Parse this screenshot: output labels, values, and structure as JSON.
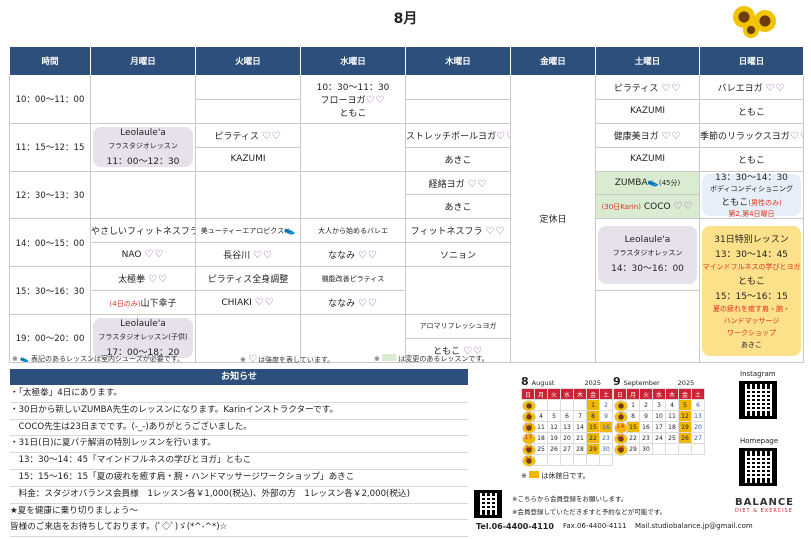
{
  "title": "8月",
  "days": [
    "時間",
    "月曜日",
    "火曜日",
    "水曜日",
    "木曜日",
    "金曜日",
    "土曜日",
    "日曜日"
  ],
  "times": [
    "10：00～11：00",
    "11：15～12：15",
    "12：30～13：30",
    "14：00～15：00",
    "15：30～16：30",
    "19：00～20：00"
  ],
  "cells": {
    "r1_wed_time": "10：30～11：30",
    "r1_wed_class": "フローヨガ",
    "r1_wed_teacher": "ともこ",
    "r1_sat_class": "ピラティス",
    "r1_sat_teacher": "KAZUMI",
    "r1_sun_class": "バレエヨガ",
    "r1_sun_teacher": "ともこ",
    "r2_mon_name": "Leolaule'a",
    "r2_mon_sub": "フラスタジオレッスン",
    "r2_mon_time": "11：00～12：30",
    "r2_tue_class": "ピラティス",
    "r2_tue_teacher": "KAZUMI",
    "r2_thu_class": "ストレッチポールヨガ",
    "r2_thu_teacher": "あきこ",
    "r2_sat_class": "健康美ヨガ",
    "r2_sat_teacher": "KAZUMI",
    "r2_sun_class": "季節のリラックスヨガ",
    "r2_sun_teacher": "ともこ",
    "r3_thu_class": "経絡ヨガ",
    "r3_thu_teacher": "あきこ",
    "r3_sat_class": "ZUMBA",
    "r3_sat_note": "(45分)",
    "r3_sat_teacher_pre": "(30日Karin)",
    "r3_sat_teacher": "COCO",
    "r3_sun_time": "13：30～14：30",
    "r3_sun_class": "ボディコンディショニング",
    "r3_sun_teacher": "ともこ",
    "r3_sun_teacher_note": "(男性のみ)",
    "r3_sun_note": "第2,第4日曜日",
    "r4_mon_class": "やさしいフィットネスフラ",
    "r4_mon_teacher": "NAO",
    "r4_tue_class": "美ューティーエアロビクス",
    "r4_tue_teacher": "長谷川",
    "r4_wed_class": "大人から始めるバレエ",
    "r4_wed_teacher": "ななみ",
    "r4_thu_class": "フィットネスフラ",
    "r4_thu_teacher": "ソニョン",
    "r4_sat_name": "Leolaule'a",
    "r4_sat_sub": "フラスタジオレッスン",
    "r4_sat_time": "14：30～16：00",
    "r4_sun_title": "31日特別レッスン",
    "r4_sun_time1": "13：30～14：45",
    "r4_sun_class1": "マインドフルネスの学びとヨガ",
    "r4_sun_teacher1": "ともこ",
    "r4_sun_time2": "15：15～16：15",
    "r4_sun_class2a": "夏の疲れを癒す肩・腕・",
    "r4_sun_class2b": "ハンドマッサージ",
    "r4_sun_class2c": "ワークショップ",
    "r4_sun_teacher2": "あきこ",
    "r5_mon_class": "太極拳",
    "r5_mon_teacher_pre": "(4日のみ)",
    "r5_mon_teacher": "山下幸子",
    "r5_tue_class": "ピラティス全身調整",
    "r5_tue_teacher": "CHIAKI",
    "r5_wed_class": "機能改善ピラティス",
    "r5_wed_teacher": "ななみ",
    "r6_mon_name": "Leolaule'a",
    "r6_mon_sub": "フラスタジオレッスン(子供)",
    "r6_mon_time": "17：00～18：20",
    "r6_thu_class": "アロマリフレッシュヨガ",
    "r6_thu_teacher": "ともこ",
    "closed": "定休日"
  },
  "notes": {
    "shoes": "表記のあるレッスンは室内シューズが必要です。",
    "hearts": "は強度を表しています。",
    "changed": "は変更のあるレッスンです。"
  },
  "news": {
    "title": "お知らせ",
    "lines": [
      "・「太極拳」4日にあります。",
      "・30日から新しいZUMBA先生のレッスンになります。Karinインストラクターです。",
      "　COCO先生は23日までです。(‐_‐)ありがとうございました。",
      "・31日(日)に夏バテ解消の特別レッスンを行います。",
      "　13：30～14：45「マインドフルネスの学びとヨガ」ともこ",
      "　15：15～16：15「夏の疲れを癒す肩・腕・ハンドマッサージワークショップ」あきこ",
      "　料金：スタジオバランス会員様　1レッスン各￥1,000(税込)、外部の方　1レッスン各￥2,000(税込)",
      "★夏を健康に乗り切りましょう～",
      "皆様のご来店をお待ちしております。(ﾟ◇ﾟ)ゞ(*^-^*)☆"
    ]
  },
  "calendar": {
    "aug_num": "8",
    "aug_name": "August",
    "aug_year": "2025",
    "sep_num": "9",
    "sep_name": "September",
    "sep_year": "2025",
    "dow": [
      "日",
      "月",
      "火",
      "水",
      "木",
      "金",
      "土"
    ],
    "aug_weeks": [
      [
        "",
        "",
        "",
        "",
        "",
        "1",
        "2"
      ],
      [
        "3",
        "4",
        "5",
        "6",
        "7",
        "8",
        "9"
      ],
      [
        "10",
        "11",
        "12",
        "13",
        "14",
        "15",
        "16"
      ],
      [
        "17",
        "18",
        "19",
        "20",
        "21",
        "22",
        "23"
      ],
      [
        "24",
        "25",
        "26",
        "27",
        "28",
        "29",
        "30"
      ],
      [
        "31",
        "",
        "",
        "",
        "",
        "",
        ""
      ]
    ],
    "sep_weeks": [
      [
        "",
        "1",
        "2",
        "3",
        "4",
        "5",
        "6"
      ],
      [
        "7",
        "8",
        "9",
        "10",
        "11",
        "12",
        "13"
      ],
      [
        "14",
        "15",
        "16",
        "17",
        "18",
        "19",
        "20"
      ],
      [
        "21",
        "22",
        "23",
        "24",
        "25",
        "26",
        "27"
      ],
      [
        "28",
        "29",
        "30",
        "",
        "",
        "",
        ""
      ]
    ],
    "legend": "は休館日です。"
  },
  "footer": {
    "member": "※こちらから会員登録をお願いします。",
    "reserve": "※会員登録していただきますと予約などが可能です。",
    "tel": "Tel.06-4400-4110",
    "fax": "Fax.06-4400-4111",
    "mail": "Mail.studiobalance.jp@gmail.com",
    "instagram": "Instagram",
    "homepage": "Homepage",
    "brand": "BALANCE",
    "brand_sub": "DIET & EXERCISE"
  },
  "hearts": "♡♡",
  "colors": {
    "header": "#2d4f7b",
    "closed": "#f2b700",
    "red": "#e0301e"
  }
}
